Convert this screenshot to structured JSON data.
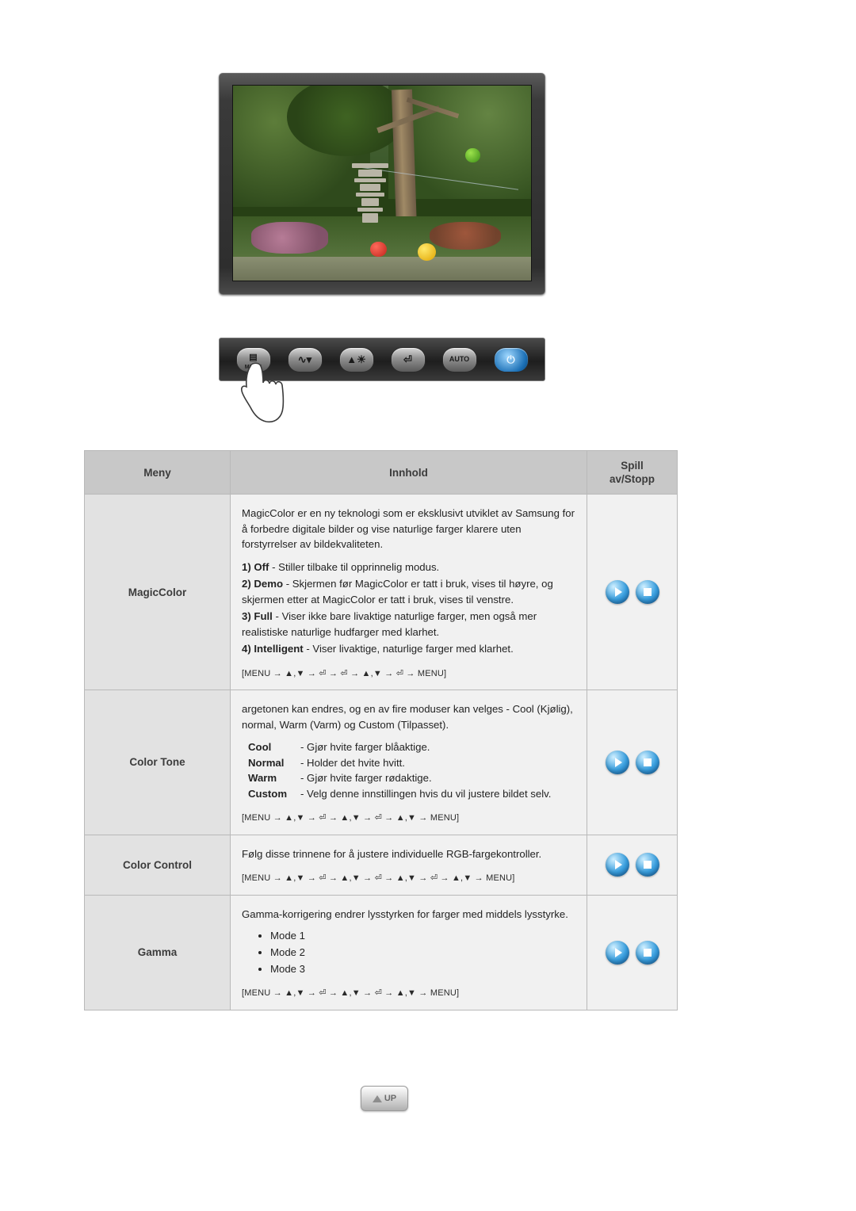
{
  "monitor": {
    "scene_description": "garden-photo",
    "controls": [
      {
        "name": "menu-button",
        "label": "MENU",
        "icon": "menu-icon"
      },
      {
        "name": "source-button",
        "label": "",
        "icon": "source-wave-icon"
      },
      {
        "name": "brightness-button",
        "label": "",
        "icon": "brightness-sun-icon"
      },
      {
        "name": "enter-button",
        "label": "",
        "icon": "enter-icon"
      },
      {
        "name": "auto-button",
        "label": "AUTO",
        "icon": "auto-icon"
      },
      {
        "name": "power-button",
        "label": "",
        "icon": "power-icon"
      }
    ]
  },
  "table": {
    "headers": {
      "menu": "Meny",
      "content": "Innhold",
      "play": "Spill",
      "play2": "av/Stopp"
    },
    "rows": [
      {
        "menu": "MagicColor",
        "intro": "MagicColor er en ny teknologi som er eksklusivt utviklet av Samsung for å forbedre digitale bilder og vise naturlige farger klarere uten forstyrrelser av bildekvaliteten.",
        "items": [
          {
            "label": "1) Off",
            "text": " - Stiller tilbake til opprinnelig modus."
          },
          {
            "label": "2) Demo",
            "text": " - Skjermen før MagicColor er tatt i bruk, vises til høyre, og skjermen etter at MagicColor er tatt i bruk, vises til venstre."
          },
          {
            "label": "3) Full",
            "text": " - Viser ikke bare livaktige naturlige farger, men også mer realistiske naturlige hudfarger med klarhet."
          },
          {
            "label": "4) Intelligent",
            "text": " - Viser livaktige, naturlige farger med klarhet."
          }
        ],
        "path": "[MENU → ▲,▼ → ⏎ → ⏎ → ▲,▼ → ⏎ → MENU]"
      },
      {
        "menu": "Color Tone",
        "intro": "argetonen kan endres, og en av fire moduser kan velges - Cool (Kjølig), normal, Warm (Varm) og Custom (Tilpasset).",
        "defs": [
          {
            "name": "Cool",
            "text": "- Gjør hvite farger blåaktige."
          },
          {
            "name": "Normal",
            "text": "- Holder det hvite hvitt."
          },
          {
            "name": "Warm",
            "text": "- Gjør hvite farger rødaktige."
          },
          {
            "name": "Custom",
            "text": "- Velg denne innstillingen hvis du vil justere bildet selv."
          }
        ],
        "path": "[MENU → ▲,▼ → ⏎ → ▲,▼ → ⏎ → ▲,▼ → MENU]"
      },
      {
        "menu": "Color Control",
        "intro": "Følg disse trinnene for å justere individuelle RGB-fargekontroller.",
        "path": "[MENU → ▲,▼ → ⏎ → ▲,▼ → ⏎ → ▲,▼ → ⏎ → ▲,▼ → MENU]"
      },
      {
        "menu": "Gamma",
        "intro": "Gamma-korrigering endrer lysstyrken for farger med middels lysstyrke.",
        "bullets": [
          "Mode 1",
          "Mode 2",
          "Mode 3"
        ],
        "path": "[MENU → ▲,▼ → ⏎ → ▲,▼ → ⏎ → ▲,▼ → MENU]"
      }
    ],
    "play_icons": {
      "play": "play-icon",
      "stop": "stop-icon"
    }
  },
  "up_button": {
    "label": "UP",
    "icon": "up-arrow-icon"
  },
  "colors": {
    "header_bg": "#c8c8c8",
    "menu_cell_bg": "#e2e2e2",
    "body_bg": "#f1f1f1",
    "border": "#b9b9b9",
    "accent_blue": "#3aa0e0"
  }
}
